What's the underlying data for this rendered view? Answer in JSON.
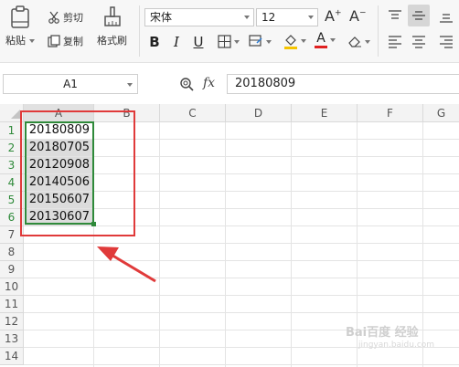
{
  "clipboard": {
    "paste_label": "粘贴",
    "cut_label": "剪切",
    "copy_label": "复制",
    "format_painter_label": "格式刷"
  },
  "font": {
    "name": "宋体",
    "size": "12",
    "grow_label": "A",
    "shrink_label": "A"
  },
  "format": {
    "bold": "B",
    "italic": "I",
    "underline": "U",
    "font_color_label": "A"
  },
  "formula_bar": {
    "cell_ref": "A1",
    "fx_label": "fx",
    "content": "20180809"
  },
  "columns": [
    "A",
    "B",
    "C",
    "D",
    "E",
    "F",
    "G"
  ],
  "rows": [
    "1",
    "2",
    "3",
    "4",
    "5",
    "6",
    "7",
    "8",
    "9",
    "10",
    "11",
    "12",
    "13",
    "14"
  ],
  "cells": {
    "A": [
      "20180809",
      "20180705",
      "20120908",
      "20140506",
      "20150607",
      "20130607"
    ]
  },
  "colors": {
    "selection_green": "#2f8a3a",
    "annotation_red": "#e03a3a",
    "font_color_bar": "#e02020",
    "fill_color_bar": "#f5c400"
  },
  "watermark": {
    "text": "Bai百度 经验",
    "sub": "jingyan.baidu.com"
  }
}
